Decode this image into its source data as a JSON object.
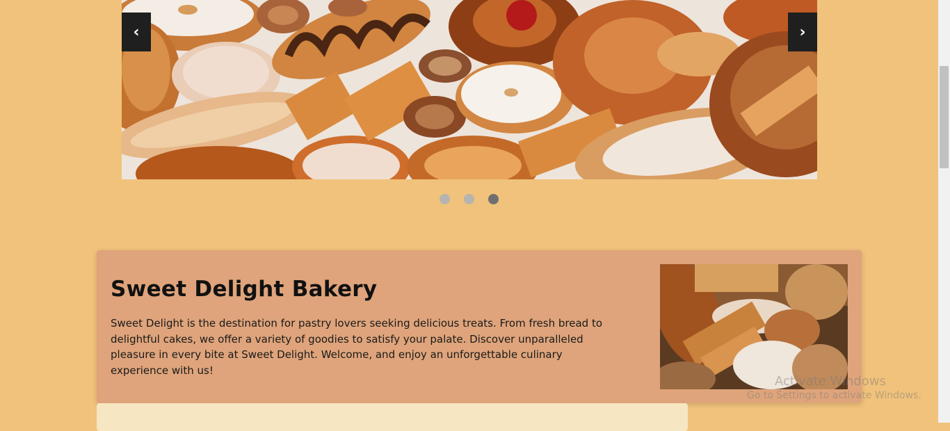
{
  "carousel": {
    "prev_label": "‹",
    "next_label": "›",
    "slide_count": 3,
    "active_slide": 3
  },
  "about": {
    "title": "Sweet Delight Bakery",
    "description": "Sweet Delight is the destination for pastry lovers seeking delicious treats. From fresh bread to delightful cakes, we offer a variety of goodies to satisfy your palate. Discover unparalleled pleasure in every bite at Sweet Delight. Welcome, and enjoy an unforgettable culinary experience with us!"
  },
  "watermark": {
    "line1": "Activate Windows",
    "line2": "Go to Settings to activate Windows."
  },
  "colors": {
    "page_background": "#f0c27b",
    "card_background": "#dfa47b",
    "lower_card_background": "#f6e6c2",
    "control_background": "#1f1f1f"
  }
}
